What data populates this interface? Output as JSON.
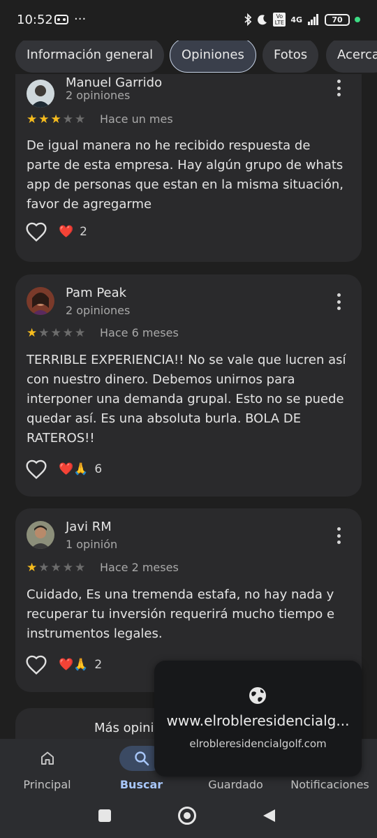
{
  "status_bar": {
    "time": "10:52",
    "dots": "···",
    "network": "4G",
    "volte": "Vo LTE",
    "battery": "70"
  },
  "tabs": [
    {
      "label": "Información general",
      "active": false
    },
    {
      "label": "Opiniones",
      "active": true
    },
    {
      "label": "Fotos",
      "active": false
    },
    {
      "label": "Acerca",
      "active": false
    }
  ],
  "reviews": [
    {
      "name": "Manuel Garrido",
      "review_count": "2 opiniones",
      "rating": 3,
      "time": "Hace un mes",
      "text": "De igual manera no he recibido respuesta de parte de esta empresa. Hay algún grupo de whats app de personas que estan en la misma situación, favor de agregarme",
      "reactions": "❤️",
      "reaction_count": "2"
    },
    {
      "name": "Pam Peak",
      "review_count": "2 opiniones",
      "rating": 1,
      "time": "Hace 6 meses",
      "text": "TERRIBLE EXPERIENCIA!! No se vale que lucren así con nuestro dinero. Debemos unirnos para interponer una demanda grupal. Esto no se puede quedar así. Es una absoluta burla. BOLA DE RATEROS!!",
      "reactions": "❤️🙏",
      "reaction_count": "6"
    },
    {
      "name": "Javi RM",
      "review_count": "1 opinión",
      "rating": 1,
      "time": "Hace 2 meses",
      "text": "Cuidado, Es una tremenda estafa, no hay nada y recuperar tu inversión requerirá mucho tiempo e instrumentos legales.",
      "reactions": "❤️🙏",
      "reaction_count": "2"
    }
  ],
  "more_reviews_button": "Más opini",
  "popup": {
    "icon": "globe-icon",
    "url": "www.elrobleresidencialg...",
    "domain": "elrobleresidencialgolf.com"
  },
  "bottom_nav": [
    {
      "label": "Principal",
      "icon": "home-icon",
      "active": false
    },
    {
      "label": "Buscar",
      "icon": "search-icon",
      "active": true
    },
    {
      "label": "Guardado",
      "icon": "bookmark-icon",
      "active": false
    },
    {
      "label": "Notificaciones",
      "icon": "bell-icon",
      "active": false
    }
  ],
  "colors": {
    "background": "#1f1f1f",
    "card": "#2a2a2c",
    "star": "#f6bc1e",
    "accent": "#a8c7fa"
  }
}
